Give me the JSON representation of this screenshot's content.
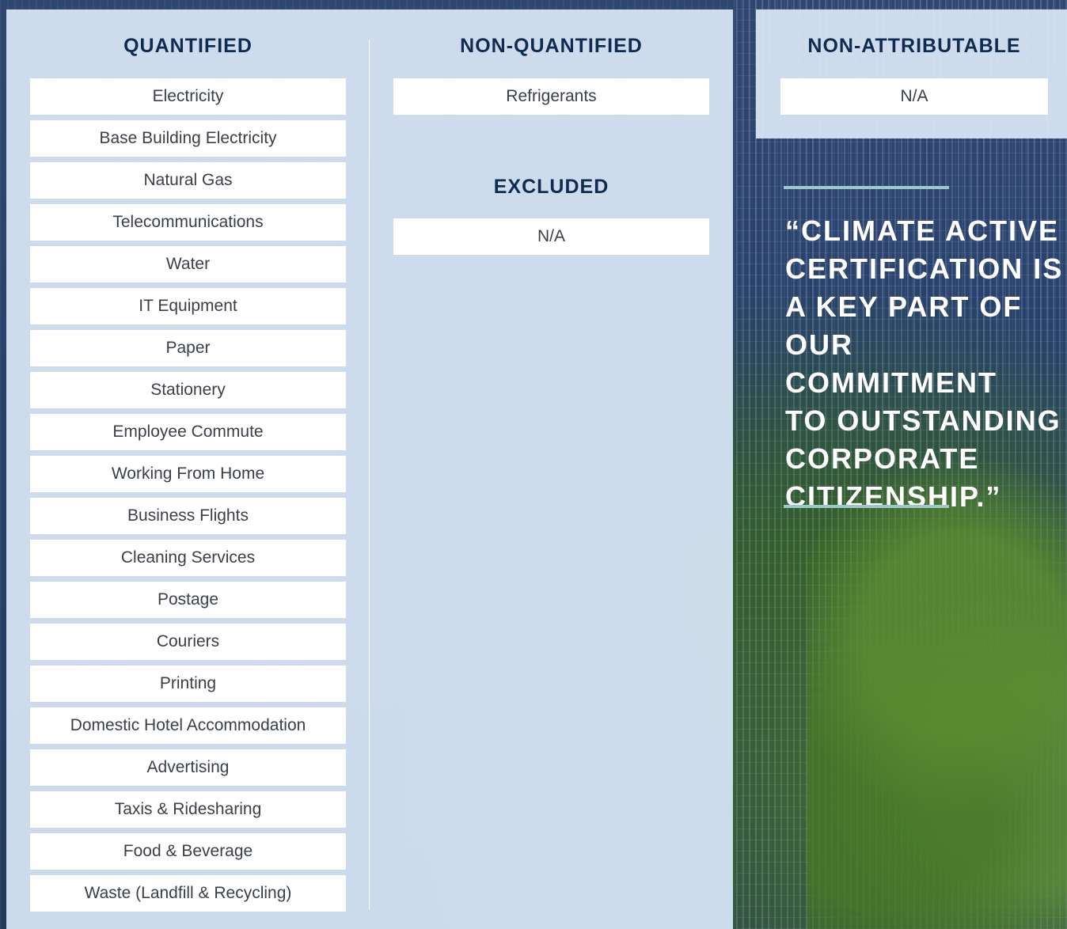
{
  "columns": {
    "quantified": {
      "heading": "QUANTIFIED",
      "items": [
        "Electricity",
        "Base Building Electricity",
        "Natural Gas",
        "Telecommunications",
        "Water",
        "IT Equipment",
        "Paper",
        "Stationery",
        "Employee Commute",
        "Working From Home",
        "Business Flights",
        "Cleaning Services",
        "Postage",
        "Couriers",
        "Printing",
        "Domestic Hotel Accommodation",
        "Advertising",
        "Taxis & Ridesharing",
        "Food & Beverage",
        "Waste (Landfill & Recycling)"
      ]
    },
    "non_quantified": {
      "heading": "NON-QUANTIFIED",
      "items": [
        "Refrigerants"
      ]
    },
    "excluded": {
      "heading": "EXCLUDED",
      "items": [
        "N/A"
      ]
    },
    "non_attributable": {
      "heading": "NON-ATTRIBUTABLE",
      "items": [
        "N/A"
      ]
    }
  },
  "quote": {
    "text": "“CLIMATE ACTIVE\nCERTIFICATION IS\nA KEY PART OF\nOUR COMMITMENT\nTO OUTSTANDING\nCORPORATE\nCITIZENSHIP.”"
  },
  "colors": {
    "heading": "#0f2b4f",
    "accent_rule": "#9cc9c8",
    "panel": "#d6e4f3"
  }
}
